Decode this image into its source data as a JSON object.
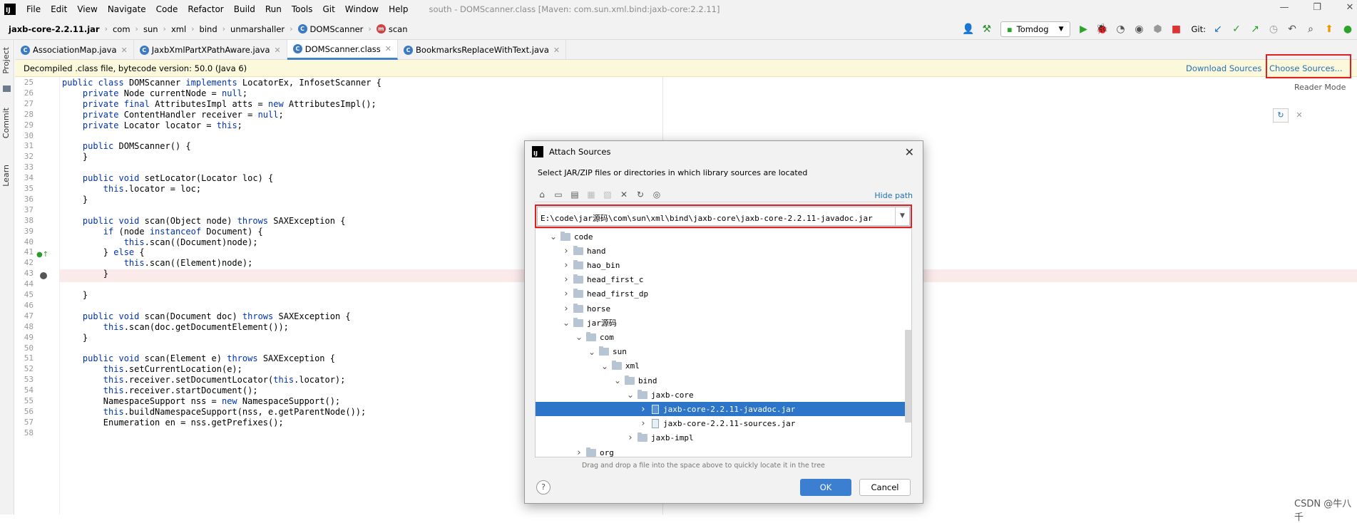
{
  "window": {
    "title": "south - DOMScanner.class [Maven: com.sun.xml.bind:jaxb-core:2.2.11]",
    "menu": [
      "File",
      "Edit",
      "View",
      "Navigate",
      "Code",
      "Refactor",
      "Build",
      "Run",
      "Tools",
      "Git",
      "Window",
      "Help"
    ]
  },
  "navbar": {
    "crumbs": [
      "jaxb-core-2.2.11.jar",
      "com",
      "sun",
      "xml",
      "bind",
      "unmarshaller",
      "DOMScanner",
      "scan"
    ],
    "run_config": "Tomdog",
    "git_label": "Git:"
  },
  "left_tools": [
    "Project",
    "Commit",
    "Learn"
  ],
  "tabs": [
    {
      "label": "AssociationMap.java"
    },
    {
      "label": "JaxbXmlPartXPathAware.java"
    },
    {
      "label": "DOMScanner.class",
      "active": true
    },
    {
      "label": "BookmarksReplaceWithText.java"
    }
  ],
  "banner": {
    "text": "Decompiled .class file, bytecode version: 50.0 (Java 6)",
    "download": "Download Sources",
    "choose": "Choose Sources..."
  },
  "reader_mode": "Reader Mode",
  "code": [
    {
      "n": "25",
      "t": "public class DOMScanner implements LocatorEx, InfosetScanner {"
    },
    {
      "n": "26",
      "t": "    private Node currentNode = null;"
    },
    {
      "n": "27",
      "t": "    private final AttributesImpl atts = new AttributesImpl();"
    },
    {
      "n": "28",
      "t": "    private ContentHandler receiver = null;"
    },
    {
      "n": "29",
      "t": "    private Locator locator = this;"
    },
    {
      "n": "30",
      "t": ""
    },
    {
      "n": "31",
      "t": "    public DOMScanner() {"
    },
    {
      "n": "32",
      "t": "    }"
    },
    {
      "n": "33",
      "t": ""
    },
    {
      "n": "34",
      "t": "    public void setLocator(Locator loc) {"
    },
    {
      "n": "35",
      "t": "        this.locator = loc;"
    },
    {
      "n": "36",
      "t": "    }"
    },
    {
      "n": "37",
      "t": ""
    },
    {
      "n": "38",
      "t": "    public void scan(Object node) throws SAXException {"
    },
    {
      "n": "39",
      "t": "        if (node instanceof Document) {"
    },
    {
      "n": "40",
      "t": "            this.scan((Document)node);"
    },
    {
      "n": "41",
      "t": "        } else {"
    },
    {
      "n": "42",
      "t": "            this.scan((Element)node);"
    },
    {
      "n": "43",
      "t": "        }"
    },
    {
      "n": "44",
      "t": ""
    },
    {
      "n": "45",
      "t": "    }"
    },
    {
      "n": "46",
      "t": ""
    },
    {
      "n": "47",
      "t": "    public void scan(Document doc) throws SAXException {"
    },
    {
      "n": "48",
      "t": "        this.scan(doc.getDocumentElement());"
    },
    {
      "n": "49",
      "t": "    }"
    },
    {
      "n": "50",
      "t": ""
    },
    {
      "n": "51",
      "t": "    public void scan(Element e) throws SAXException {"
    },
    {
      "n": "52",
      "t": "        this.setCurrentLocation(e);"
    },
    {
      "n": "53",
      "t": "        this.receiver.setDocumentLocator(this.locator);"
    },
    {
      "n": "54",
      "t": "        this.receiver.startDocument();"
    },
    {
      "n": "55",
      "t": "        NamespaceSupport nss = new NamespaceSupport();"
    },
    {
      "n": "56",
      "t": "        this.buildNamespaceSupport(nss, e.getParentNode());"
    },
    {
      "n": "57",
      "t": "        Enumeration en = nss.getPrefixes();"
    },
    {
      "n": "58",
      "t": ""
    }
  ],
  "dialog": {
    "title": "Attach Sources",
    "description": "Select JAR/ZIP files or directories in which library sources are located",
    "hide_path": "Hide path",
    "path": "E:\\code\\jar源码\\com\\sun\\xml\\bind\\jaxb-core\\jaxb-core-2.2.11-javadoc.jar",
    "tree": [
      {
        "label": "code",
        "lvl": 1,
        "open": true,
        "kind": "folder"
      },
      {
        "label": "hand",
        "lvl": 2,
        "open": false,
        "kind": "folder"
      },
      {
        "label": "hao_bin",
        "lvl": 2,
        "open": false,
        "kind": "folder"
      },
      {
        "label": "head_first_c",
        "lvl": 2,
        "open": false,
        "kind": "folder"
      },
      {
        "label": "head_first_dp",
        "lvl": 2,
        "open": false,
        "kind": "folder"
      },
      {
        "label": "horse",
        "lvl": 2,
        "open": false,
        "kind": "folder"
      },
      {
        "label": "jar源码",
        "lvl": 2,
        "open": true,
        "kind": "folder"
      },
      {
        "label": "com",
        "lvl": 3,
        "open": true,
        "kind": "folder"
      },
      {
        "label": "sun",
        "lvl": 4,
        "open": true,
        "kind": "folder"
      },
      {
        "label": "xml",
        "lvl": 5,
        "open": true,
        "kind": "folder"
      },
      {
        "label": "bind",
        "lvl": 6,
        "open": true,
        "kind": "folder"
      },
      {
        "label": "jaxb-core",
        "lvl": 7,
        "open": true,
        "kind": "folder"
      },
      {
        "label": "jaxb-core-2.2.11-javadoc.jar",
        "lvl": 8,
        "open": false,
        "kind": "jar",
        "selected": true
      },
      {
        "label": "jaxb-core-2.2.11-sources.jar",
        "lvl": 8,
        "open": false,
        "kind": "jar"
      },
      {
        "label": "jaxb-impl",
        "lvl": 7,
        "open": false,
        "kind": "folder"
      },
      {
        "label": "org",
        "lvl": 3,
        "open": false,
        "kind": "folder"
      }
    ],
    "drag_hint": "Drag and drop a file into the space above to quickly locate it in the tree",
    "ok": "OK",
    "cancel": "Cancel"
  },
  "watermark": "CSDN @牛八千"
}
